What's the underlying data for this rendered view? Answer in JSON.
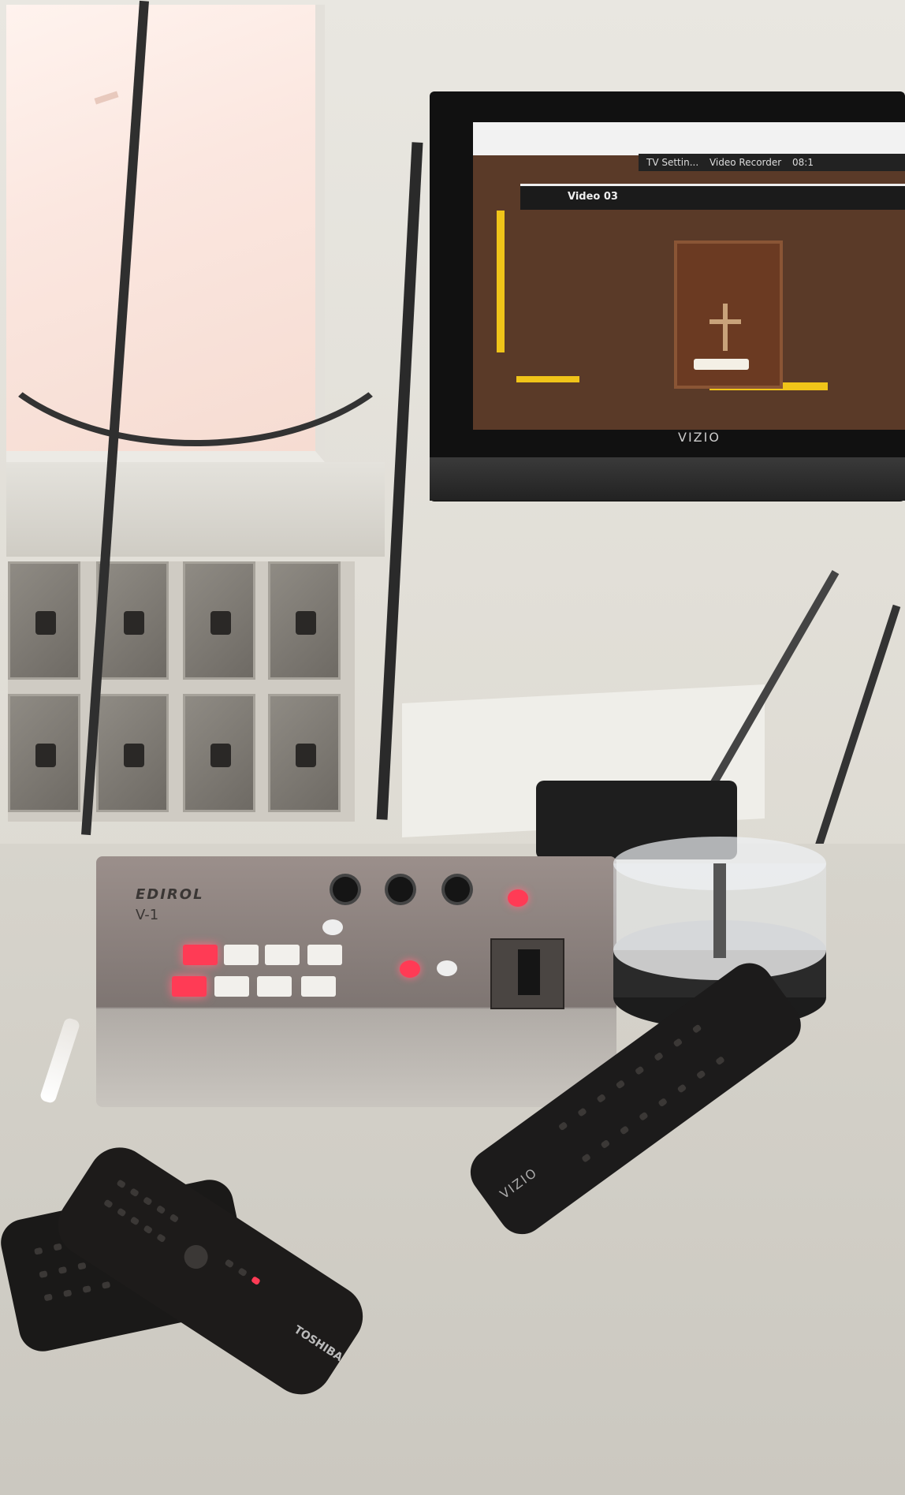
{
  "scene": {
    "tv_screen": {
      "status_left": "TV Settin...",
      "status_right": "Video Recorder",
      "time": "08:1",
      "input_label": "Video 03"
    },
    "tv_brand": "VIZIO",
    "mixer": {
      "brand": "EDIROL",
      "model": "V-1"
    },
    "remotes": {
      "toshiba_brand": "TOSHIBA",
      "vizio_brand": "VIZIO"
    }
  }
}
